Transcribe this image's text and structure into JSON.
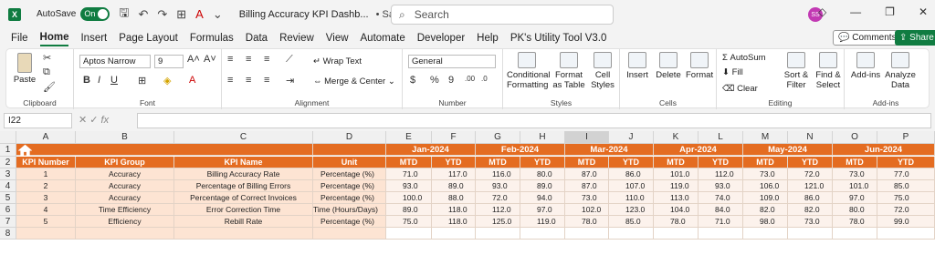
{
  "titlebar": {
    "autosave": "AutoSave",
    "toggle": "On",
    "title": "Billing Accuracy KPI Dashb...",
    "saved": "• Saved",
    "search_placeholder": "Search",
    "avatar": "SS"
  },
  "menu": [
    "File",
    "Home",
    "Insert",
    "Page Layout",
    "Formulas",
    "Data",
    "Review",
    "View",
    "Automate",
    "Developer",
    "Help",
    "PK's Utility Tool V3.0"
  ],
  "menu_active": "Home",
  "comments": "Comments",
  "share": "Share",
  "ribbon": {
    "clipboard": {
      "label": "Clipboard",
      "paste": "Paste"
    },
    "font": {
      "label": "Font",
      "name": "Aptos Narrow",
      "size": "9"
    },
    "alignment": {
      "label": "Alignment",
      "wrap": "Wrap Text",
      "merge": "Merge & Center"
    },
    "number": {
      "label": "Number",
      "format": "General"
    },
    "styles": {
      "label": "Styles",
      "cond": "Conditional Formatting",
      "format_table": "Format as Table",
      "cell_styles": "Cell Styles"
    },
    "cells": {
      "label": "Cells",
      "insert": "Insert",
      "delete": "Delete",
      "format": "Format"
    },
    "editing": {
      "label": "Editing",
      "autosum": "AutoSum",
      "fill": "Fill",
      "clear": "Clear",
      "sort": "Sort & Filter",
      "find": "Find & Select"
    },
    "addins": {
      "label": "Add-ins",
      "addins": "Add-ins",
      "analyze": "Analyze Data"
    }
  },
  "namebox": "I22",
  "columns": [
    "A",
    "B",
    "C",
    "D",
    "E",
    "F",
    "G",
    "H",
    "I",
    "J",
    "K",
    "L",
    "M",
    "N",
    "O",
    "P"
  ],
  "selected_col": "I",
  "rows": [
    "1",
    "2",
    "3",
    "4",
    "5",
    "6",
    "7",
    "8"
  ],
  "months": [
    "Jan-2024",
    "Feb-2024",
    "Mar-2024",
    "Apr-2024",
    "May-2024",
    "Jun-2024"
  ],
  "headers": {
    "kpi_number": "KPI Number",
    "kpi_group": "KPI Group",
    "kpi_name": "KPI Name",
    "unit": "Unit",
    "mtd": "MTD",
    "ytd": "YTD"
  },
  "data": [
    {
      "num": "1",
      "group": "Accuracy",
      "name": "Billing Accuracy Rate",
      "unit": "Percentage (%)",
      "vals": [
        "71.0",
        "117.0",
        "116.0",
        "80.0",
        "87.0",
        "86.0",
        "101.0",
        "112.0",
        "73.0",
        "72.0",
        "73.0",
        "77.0"
      ]
    },
    {
      "num": "2",
      "group": "Accuracy",
      "name": "Percentage of Billing Errors",
      "unit": "Percentage (%)",
      "vals": [
        "93.0",
        "89.0",
        "93.0",
        "89.0",
        "87.0",
        "107.0",
        "119.0",
        "93.0",
        "106.0",
        "121.0",
        "101.0",
        "85.0"
      ]
    },
    {
      "num": "3",
      "group": "Accuracy",
      "name": "Percentage of Correct Invoices",
      "unit": "Percentage (%)",
      "vals": [
        "100.0",
        "88.0",
        "72.0",
        "94.0",
        "73.0",
        "110.0",
        "113.0",
        "74.0",
        "109.0",
        "86.0",
        "97.0",
        "75.0"
      ]
    },
    {
      "num": "4",
      "group": "Time Efficiency",
      "name": "Error Correction Time",
      "unit": "Time (Hours/Days)",
      "vals": [
        "89.0",
        "118.0",
        "112.0",
        "97.0",
        "102.0",
        "123.0",
        "104.0",
        "84.0",
        "82.0",
        "82.0",
        "80.0",
        "72.0"
      ]
    },
    {
      "num": "5",
      "group": "Efficiency",
      "name": "Rebill Rate",
      "unit": "Percentage (%)",
      "vals": [
        "75.0",
        "118.0",
        "125.0",
        "119.0",
        "78.0",
        "85.0",
        "78.0",
        "71.0",
        "98.0",
        "73.0",
        "78.0",
        "99.0"
      ]
    }
  ],
  "colors": {
    "header": "#e46c21",
    "peach": "#fde4d3",
    "light": "#fcf2ec",
    "excel_green": "#107c41"
  }
}
